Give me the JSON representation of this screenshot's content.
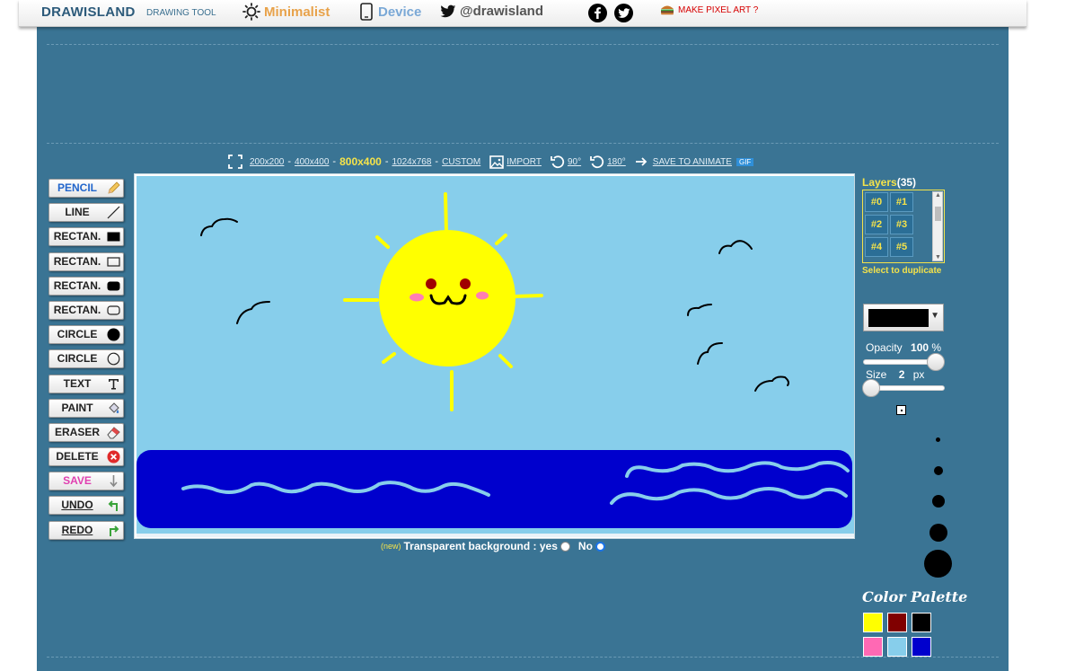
{
  "topbar": {
    "brand": "DRAWISLAND",
    "subtitle": "DRAWING TOOL",
    "minimalist": "Minimalist",
    "device": "Device",
    "twitter": "@drawisland",
    "pixel_art": "MAKE PIXEL ART ?"
  },
  "canvas_toolbar": {
    "fullscreen_icon": "fullscreen-icon",
    "sizes": [
      "200x200",
      "400x400",
      "800x400",
      "1024x768",
      "CUSTOM"
    ],
    "current_size": "800x400",
    "import": "IMPORT",
    "rotate90": "90°",
    "rotate180": "180°",
    "save_animate": "SAVE TO ANIMATE",
    "gif": "GIF"
  },
  "tools": [
    {
      "label": "PENCIL",
      "icon": "pencil-icon"
    },
    {
      "label": "LINE",
      "icon": "line-icon"
    },
    {
      "label": "RECTAN.",
      "icon": "filled-rect-icon"
    },
    {
      "label": "RECTAN.",
      "icon": "outline-rect-icon"
    },
    {
      "label": "RECTAN.",
      "icon": "filled-rounded-rect-icon"
    },
    {
      "label": "RECTAN.",
      "icon": "outline-rounded-rect-icon"
    },
    {
      "label": "CIRCLE",
      "icon": "filled-circle-icon"
    },
    {
      "label": "CIRCLE",
      "icon": "outline-circle-icon"
    },
    {
      "label": "TEXT",
      "icon": "text-icon"
    },
    {
      "label": "PAINT",
      "icon": "paint-bucket-icon"
    },
    {
      "label": "ERASER",
      "icon": "eraser-icon"
    },
    {
      "label": "DELETE",
      "icon": "delete-icon"
    },
    {
      "label": "SAVE",
      "icon": "save-arrow-icon"
    },
    {
      "label": "UNDO",
      "icon": "undo-arrow-icon"
    },
    {
      "label": "REDO",
      "icon": "redo-arrow-icon"
    }
  ],
  "transparent": {
    "new": "(new)",
    "label": "Transparent background : yes",
    "no": "No",
    "selected": "No"
  },
  "layers": {
    "title": "Layers",
    "count": "(35)",
    "items": [
      "#0",
      "#1",
      "#2",
      "#3",
      "#4",
      "#5"
    ],
    "select_to_duplicate": "Select to duplicate"
  },
  "brush": {
    "color": "#000000",
    "opacity_label": "Opacity",
    "opacity_value": "100",
    "opacity_unit": "%",
    "size_label": "Size",
    "size_value": "2",
    "size_unit": "px"
  },
  "palette": {
    "title": "Color Palette",
    "colors": [
      "#ffff00",
      "#800000",
      "#000000",
      "#ff69b4",
      "#87ceeb",
      "#0000cd"
    ]
  },
  "colors": {
    "panel": "#3a7494",
    "sky": "#87ceeb",
    "sun": "#ffff00",
    "sea": "#0000cd",
    "waves": "#87ceeb",
    "accent": "#f5e34a"
  }
}
